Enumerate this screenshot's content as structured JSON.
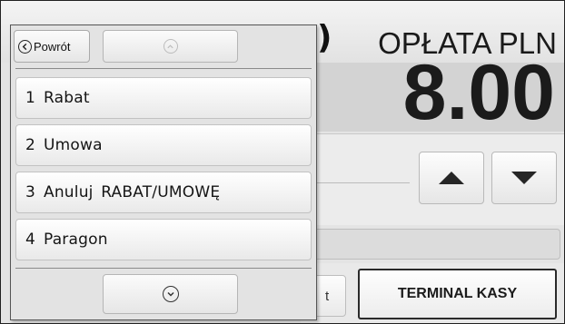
{
  "header": {
    "partial_left_char": ")",
    "fee_label": "OPŁATA PLN"
  },
  "fee": {
    "value": "8.00"
  },
  "buttons": {
    "terminal": "TERMINAL KASY",
    "cutoff_fragment": "t"
  },
  "popup": {
    "back_label": "Powrót",
    "items": [
      {
        "number": "1",
        "label": "Rabat"
      },
      {
        "number": "2",
        "label": "Umowa"
      },
      {
        "number": "3",
        "label": "Anuluj RABAT/UMOWĘ"
      },
      {
        "number": "4",
        "label": "Paragon"
      }
    ]
  },
  "icons": {
    "back": "chevron-left-circle-icon",
    "scroll_up": "chevron-up-circle-icon",
    "scroll_down": "chevron-down-circle-icon",
    "nav_up": "triangle-up-icon",
    "nav_down": "triangle-down-icon"
  }
}
